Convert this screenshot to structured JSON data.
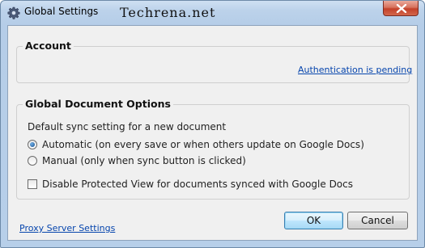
{
  "window": {
    "title": "Global Settings",
    "watermark": "Techrena.net"
  },
  "account": {
    "heading": "Account",
    "auth_link": "Authentication is pending"
  },
  "document_options": {
    "heading": "Global Document Options",
    "sync_label": "Default sync setting for a new document",
    "radio_automatic": "Automatic (on every save or when others update on Google Docs)",
    "radio_manual": "Manual (only when sync button is clicked)",
    "selected": "automatic",
    "checkbox_protected_view": "Disable Protected View for documents synced with Google Docs",
    "protected_view_checked": false
  },
  "footer": {
    "proxy_link": "Proxy Server Settings",
    "ok_label": "OK",
    "cancel_label": "Cancel"
  },
  "icons": {
    "window": "gear-icon",
    "close": "close-icon"
  },
  "colors": {
    "link": "#0645ad",
    "close_button": "#c4412a",
    "title_bar": "#bcd2ea"
  }
}
